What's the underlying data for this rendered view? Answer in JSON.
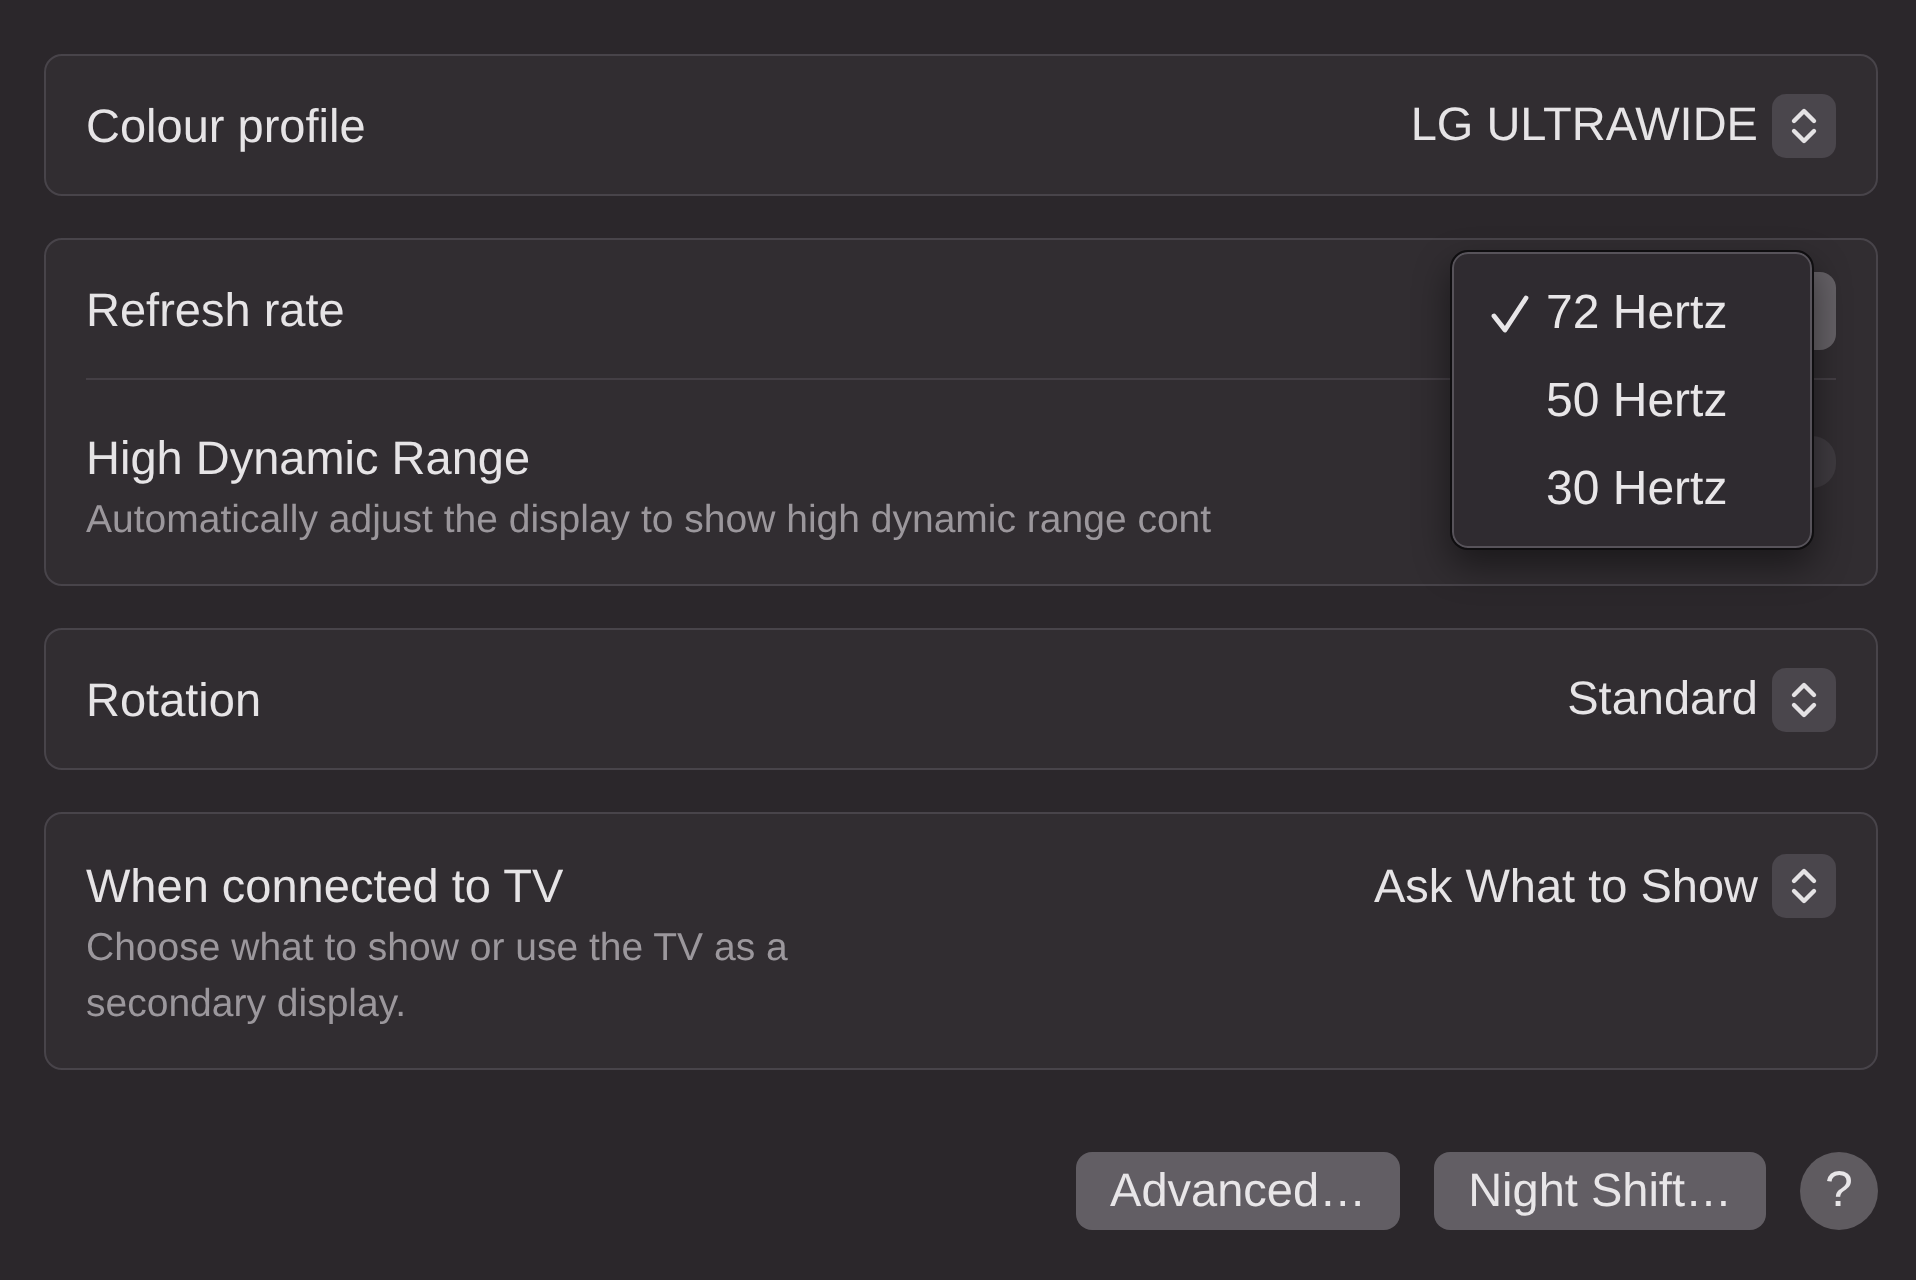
{
  "panels": [
    {
      "rows": [
        {
          "kind": "popup",
          "label": "Colour profile",
          "value": "LG ULTRAWIDE"
        }
      ]
    },
    {
      "rows": [
        {
          "kind": "popup-open",
          "label": "Refresh rate",
          "menu": {
            "items": [
              {
                "label": "72 Hertz",
                "checked": true
              },
              {
                "label": "50 Hertz",
                "checked": false
              },
              {
                "label": "30 Hertz",
                "checked": false
              }
            ]
          }
        },
        {
          "kind": "toggle",
          "label": "High Dynamic Range",
          "description": "Automatically adjust the display to show high dynamic range cont",
          "on": false
        }
      ]
    },
    {
      "rows": [
        {
          "kind": "popup",
          "label": "Rotation",
          "value": "Standard"
        }
      ]
    },
    {
      "rows": [
        {
          "kind": "popup",
          "label": "When connected to TV",
          "description": "Choose what to show or use the TV as a secondary display.",
          "value": "Ask What to Show"
        }
      ]
    }
  ],
  "buttons": [
    "Advanced…",
    "Night Shift…"
  ],
  "help_button": {
    "label": "?"
  }
}
